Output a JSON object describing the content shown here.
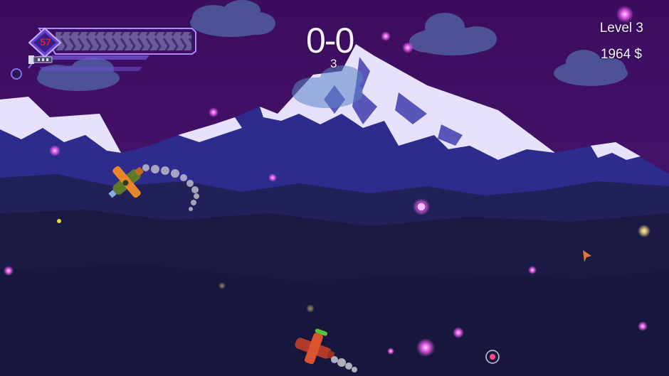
{
  "hud": {
    "health_value": "57",
    "health_fraction": 0.99,
    "score": "0-0",
    "score_sub": "3",
    "level": "Level 3",
    "money": "1964 $"
  },
  "colors": {
    "sky": "#3d1260",
    "mountain_snow": "#e6e0fb",
    "mountain_rock": "#2c2a8e",
    "ground": "#1c1b46",
    "cloud": "#4d5499",
    "hud_frame": "#8560e8",
    "health_red": "#e02020"
  },
  "icons": [
    "health-diamond-icon",
    "gun-icon",
    "cursor-arrow-icon",
    "target-reticle-icon"
  ]
}
